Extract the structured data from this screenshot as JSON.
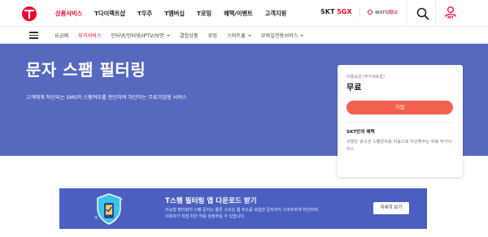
{
  "header": {
    "gnb": [
      "상품서비스",
      "T다이렉트샵",
      "T우주",
      "T멤버십",
      "T로밍",
      "혜택/이벤트",
      "고객지원"
    ],
    "active_index": 0,
    "brand_5gx_prefix": "SKT",
    "brand_5gx_highlight": "5GX",
    "brand_worldbiz": "world",
    "brand_worldbiz_suffix": "Biz",
    "my_label": "MY",
    "accent_color": "#ea002c"
  },
  "subnav": {
    "items": [
      {
        "label": "요금제",
        "active": false,
        "dropdown": false
      },
      {
        "label": "부가서비스",
        "active": true,
        "dropdown": false
      },
      {
        "label": "인터넷/인터넷/IPTV/보안",
        "active": false,
        "dropdown": true
      },
      {
        "label": "결합상품",
        "active": false,
        "dropdown": false
      },
      {
        "label": "로밍",
        "active": false,
        "dropdown": false
      },
      {
        "label": "스마트홈",
        "active": false,
        "dropdown": true
      },
      {
        "label": "모바일전용서비스",
        "active": false,
        "dropdown": true
      }
    ]
  },
  "hero": {
    "title": "문자 스팸 필터링",
    "description": "고객에게 착신되는 SMS의 스팸여부를 판단하여 차단하는 무료가입형 서비스",
    "background_color": "#5769bf"
  },
  "price_card": {
    "label": "이용요금 (부가세포함)",
    "price": "무료",
    "join_button": "가입",
    "benefit_title": "SKT만의 혜택",
    "benefit_desc": "귀찮은 광고성 스팸문자를 자동으로 차단해주는 무료 부가서비스"
  },
  "banner": {
    "title": "T스팸 필터링 앱 다운로드 받기",
    "desc_line1": "지능형 필터링이 스팸 문자는 물론 스미싱 웹 주소를 포함한 문자까지 스마트하게 차단하며,",
    "desc_line2": "사용자가 직접 차단 허용 설정하실 수 있습니다.",
    "button": "자세히 보기",
    "background_color": "#4a5fc0"
  }
}
